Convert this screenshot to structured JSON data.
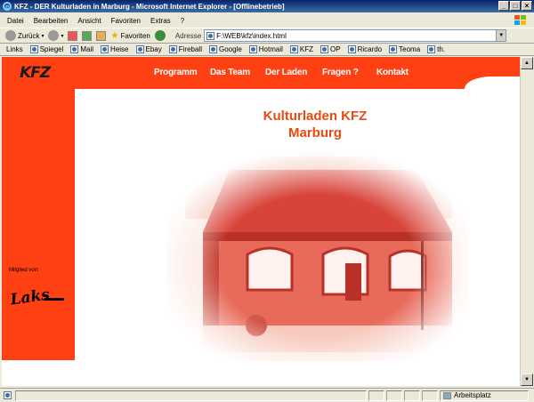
{
  "window": {
    "title": "KFZ - DER Kulturladen in Marburg - Microsoft Internet Explorer - [Offlinebetrieb]"
  },
  "menu": [
    "Datei",
    "Bearbeiten",
    "Ansicht",
    "Favoriten",
    "Extras",
    "?"
  ],
  "toolbar": {
    "back": "Zurück",
    "favorites": "Favoriten",
    "address_label": "Adresse",
    "address_value": "F:\\WEB\\kfz\\index.html"
  },
  "links": {
    "label": "Links",
    "items": [
      "Spiegel",
      "Mail",
      "Heise",
      "Ebay",
      "Fireball",
      "Google",
      "Hotmail",
      "KFZ",
      "OP",
      "Ricardo",
      "Teoma",
      "th."
    ]
  },
  "page": {
    "logo": "KFZ",
    "nav": [
      "Programm",
      "Das Team",
      "Der Laden",
      "Fragen ?",
      "Kontakt"
    ],
    "heading_line1": "Kulturladen KFZ",
    "heading_line2": "Marburg",
    "member_label": "Mitglied von:",
    "laks_logo": "Laks"
  },
  "status": {
    "zone": "Arbeitsplatz"
  },
  "colors": {
    "brand_red": "#ff4013",
    "heading": "#e84a10"
  }
}
